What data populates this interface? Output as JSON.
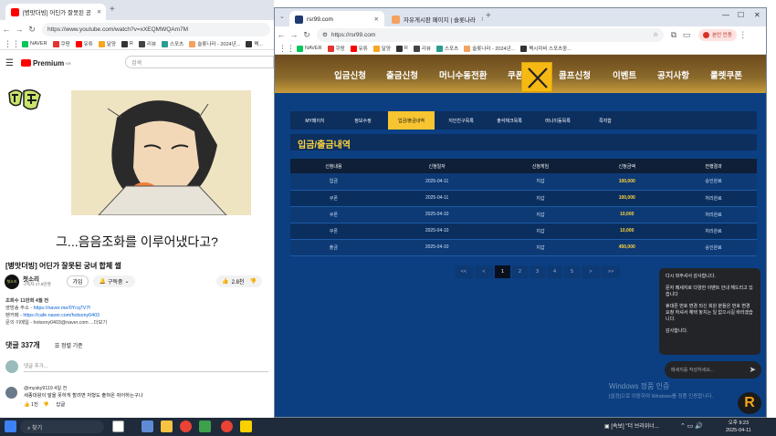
{
  "left_browser": {
    "tab_title": "[병맛더빙] 어딘가 잘못된 공",
    "url": "https://www.youtube.com/watch?v=xXEQMWQAm7M",
    "bookmarks": [
      "NAVER",
      "쿠팡",
      "유튜",
      "달양",
      "R",
      "리뷰",
      "스포츠",
      "슬롯나라 - 2024년...",
      "팩..."
    ],
    "youtube": {
      "logo": "Premium",
      "logo_sup": "KR",
      "search_placeholder": "검색",
      "thumbnail_subtitle": "그...음음조화를 이루어냈다고?",
      "video_title": "[병맛더빙] 어딘가 잘못된 궁녀 합체 썰",
      "channel_name": "첫소리",
      "subscribers": "구독자 17.9만명",
      "join_label": "가입",
      "subscribe_label": "구독중",
      "likes": "2.8천",
      "description": [
        "조회수 11만회  4월 전",
        "영방송 주소 -",
        "팬카페 -",
        "문의 이메일 - hotsony0403@naver.com ...더보기"
      ],
      "desc_link_1": "https://naver.me/0Ycq7V7f",
      "desc_link_2": "https://cafe.naver.com/hotsony0403",
      "comments_count": "댓글 337개",
      "sort_label": "정렬 기준",
      "comment_placeholder": "댓글 추가...",
      "comment_author": "@mysky9119  4일 전",
      "comment_text": "세종대왕이 말을 못하게 할려면 처형도 출혀온 쥐어하는구나",
      "comment_likes": "1천",
      "reply_label": "답글"
    }
  },
  "right_browser": {
    "tab_1": "rsr99.com",
    "tab_2": "자유게시판 페이지 | 슬롯나라",
    "url": "https://rsr99.com",
    "profile_label": "본인 인증",
    "bookmarks": [
      "NAVER",
      "쿠팡",
      "유튜",
      "달양",
      "R",
      "리뷰",
      "스포츠",
      "슬롯나라 - 2024년...",
      "팩시미비 스포츠중..."
    ],
    "top_menu": [
      "입금신청",
      "출금신청",
      "머니수동전환",
      "쿠폰",
      "콤프신청",
      "이벤트",
      "공지사항",
      "룰렛쿠폰"
    ],
    "sub_tabs": [
      "MY페이지",
      "정보수정",
      "입금/출금내역",
      "지인친구목록",
      "출석체크목록",
      "머니이동목록",
      "쪽지함"
    ],
    "active_sub_tab": "입금/출금내역",
    "page_heading": "입금/출금내역",
    "table_headers": [
      "신청내용",
      "신청일자",
      "신청게임",
      "신청금액",
      "전행결과"
    ],
    "table_rows": [
      [
        "입금",
        "2025-04-11",
        "지갑",
        "100,000",
        "승인완료"
      ],
      [
        "쿠폰",
        "2025-04-11",
        "지갑",
        "100,000",
        "처리완료"
      ],
      [
        "쿠폰",
        "2025-04-10",
        "지갑",
        "10,000",
        "처리완료"
      ],
      [
        "쿠폰",
        "2025-04-10",
        "지갑",
        "10,000",
        "처리완료"
      ],
      [
        "출금",
        "2025-04-10",
        "지갑",
        "450,000",
        "승인완료"
      ]
    ],
    "pagination": [
      "<<",
      "<",
      "1",
      "2",
      "3",
      "4",
      "5",
      ">",
      ">>"
    ],
    "current_page": "1"
  },
  "chat": {
    "greeting": "다시 와주셔서 감사합니다.",
    "message_1": "문자 메세지로 다양한 이벤트 안내 해드리고 있습니다",
    "message_2": "휴대폰 번호 변경 되신 회원 분들은 번호 변경 요청 하셔서 혜택 놓치는 일 없으시길 바라겠습니다.",
    "thanks": "감사합니다.",
    "input_placeholder": "메세지를 작성하세요..."
  },
  "watermark": {
    "line1": "Windows 정품 인증",
    "line2": "[설정]으로 이동하여 Windows를 정품 인증합니다."
  },
  "taskbar": {
    "search_placeholder": "찾기",
    "news": "[속보] \"더 브라위너...",
    "time": "오후 9:23",
    "date": "2025-04-11"
  },
  "colors": {
    "site_bg": "#0b3f82",
    "accent_yellow": "#f7c531",
    "amount_yellow": "#ffd43d"
  }
}
